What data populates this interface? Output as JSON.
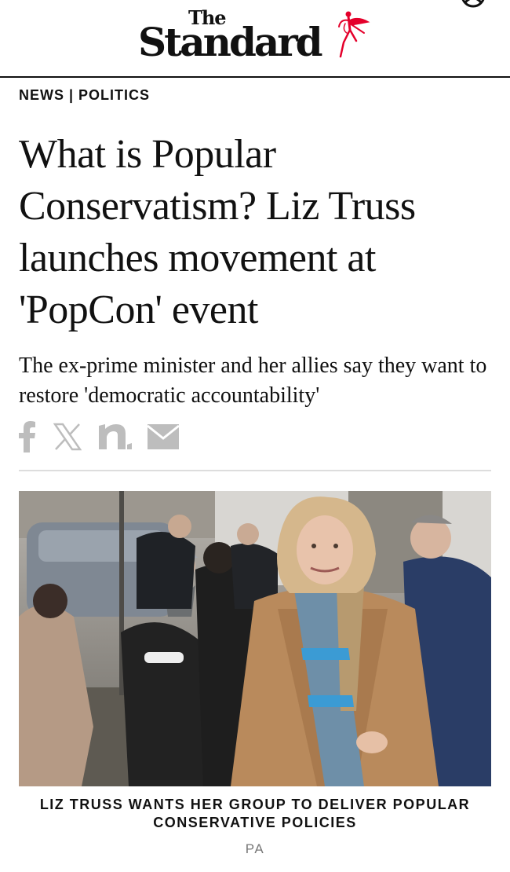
{
  "header": {
    "logo_the": "The",
    "logo_standard": "Standard",
    "brand_color": "#e4002b"
  },
  "breadcrumb": {
    "items": [
      "NEWS",
      "POLITICS"
    ],
    "separator": "|"
  },
  "article": {
    "headline": "What is Popular Conservatism? Liz Truss launches movement at 'PopCon' event",
    "standfirst": "The ex-prime minister and her allies say they want to restore 'democratic accountability'"
  },
  "share": {
    "icons": [
      "facebook-icon",
      "x-icon",
      "newsnow-icon",
      "email-icon"
    ],
    "icon_color": "#bdbdbd"
  },
  "image": {
    "caption": "LIZ TRUSS WANTS HER GROUP TO DELIVER POPULAR CONSERVATIVE POLICIES",
    "credit": "PA"
  }
}
